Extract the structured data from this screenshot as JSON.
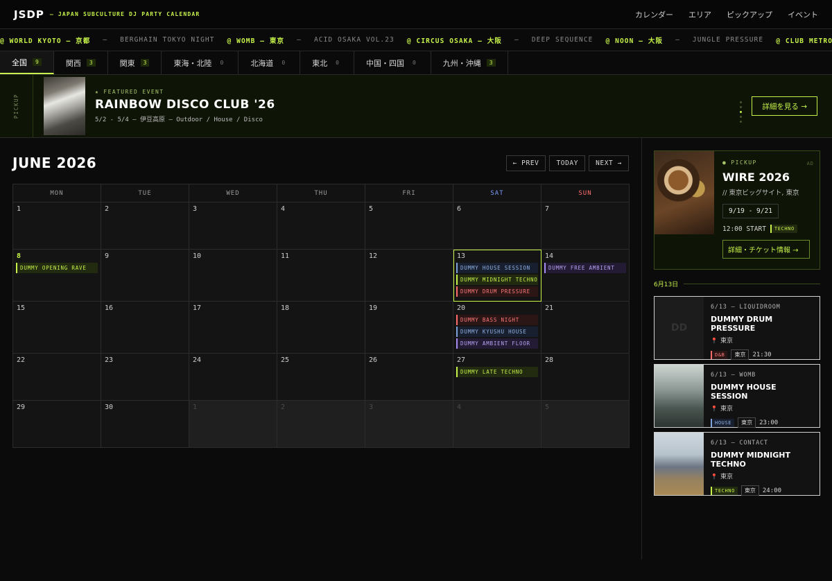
{
  "header": {
    "logo": "JSDP",
    "tagline": "— JAPAN SUBCULTURE DJ PARTY CALENDAR",
    "nav": [
      "カレンダー",
      "エリア",
      "ピックアップ",
      "イベント"
    ]
  },
  "ticker": [
    {
      "text": "@ WORLD KYOTO — 京都",
      "hl": true
    },
    {
      "text": "—",
      "hl": false
    },
    {
      "text": "BERGHAIN TOKYO NIGHT",
      "hl": false
    },
    {
      "text": "@ WOMB — 東京",
      "hl": true
    },
    {
      "text": "—",
      "hl": false
    },
    {
      "text": "ACID OSAKA VOL.23",
      "hl": false
    },
    {
      "text": "@ CIRCUS OSAKA — 大阪",
      "hl": true
    },
    {
      "text": "—",
      "hl": false
    },
    {
      "text": "DEEP SEQUENCE",
      "hl": false
    },
    {
      "text": "@ NOON — 大阪",
      "hl": true
    },
    {
      "text": "—",
      "hl": false
    },
    {
      "text": "JUNGLE PRESSURE",
      "hl": false
    },
    {
      "text": "@ CLUB METRO — 京",
      "hl": true
    }
  ],
  "tabs": [
    {
      "label": "全国",
      "count": "9",
      "active": true,
      "on": true
    },
    {
      "label": "関西",
      "count": "3",
      "active": false,
      "on": true
    },
    {
      "label": "関東",
      "count": "3",
      "active": false,
      "on": true
    },
    {
      "label": "東海・北陸",
      "count": "0",
      "active": false,
      "on": false
    },
    {
      "label": "北海道",
      "count": "0",
      "active": false,
      "on": false
    },
    {
      "label": "東北",
      "count": "0",
      "active": false,
      "on": false
    },
    {
      "label": "中国・四国",
      "count": "0",
      "active": false,
      "on": false
    },
    {
      "label": "九州・沖縄",
      "count": "3",
      "active": false,
      "on": true
    }
  ],
  "featured": {
    "side_label": "PICKUP",
    "label": "★ FEATURED EVENT",
    "title": "RAINBOW DISCO CLUB '26",
    "meta": "5/2 - 5/4 — 伊豆高原 — Outdoor / House / Disco",
    "button": "詳細を見る →"
  },
  "calendar": {
    "title": "JUNE 2026",
    "prev": "← PREV",
    "today": "TODAY",
    "next": "NEXT →",
    "dows": [
      "MON",
      "TUE",
      "WED",
      "THU",
      "FRI",
      "SAT",
      "SUN"
    ],
    "weeks": [
      {
        "h": 68,
        "days": [
          {
            "d": "1"
          },
          {
            "d": "2"
          },
          {
            "d": "3"
          },
          {
            "d": "4"
          },
          {
            "d": "5"
          },
          {
            "d": "6"
          },
          {
            "d": "7"
          }
        ]
      },
      {
        "h": 75,
        "days": [
          {
            "d": "8",
            "hl": true,
            "events": [
              {
                "t": "DUMMY OPENING RAVE",
                "g": "techno"
              }
            ]
          },
          {
            "d": "9"
          },
          {
            "d": "10"
          },
          {
            "d": "11"
          },
          {
            "d": "12"
          },
          {
            "d": "13",
            "sel": true,
            "events": [
              {
                "t": "DUMMY HOUSE SESSION",
                "g": "house"
              },
              {
                "t": "DUMMY MIDNIGHT TECHNO",
                "g": "techno"
              },
              {
                "t": "DUMMY DRUM PRESSURE",
                "g": "dnb"
              }
            ]
          },
          {
            "d": "14",
            "events": [
              {
                "t": "DUMMY FREE AMBIENT",
                "g": "ambient"
              }
            ]
          }
        ]
      },
      {
        "h": 75,
        "days": [
          {
            "d": "15"
          },
          {
            "d": "16"
          },
          {
            "d": "17"
          },
          {
            "d": "18"
          },
          {
            "d": "19"
          },
          {
            "d": "20",
            "events": [
              {
                "t": "DUMMY BASS NIGHT",
                "g": "dnb"
              },
              {
                "t": "DUMMY KYUSHU HOUSE",
                "g": "house"
              },
              {
                "t": "DUMMY AMBIENT FLOOR",
                "g": "ambient"
              }
            ]
          },
          {
            "d": "21"
          }
        ]
      },
      {
        "h": 68,
        "days": [
          {
            "d": "22"
          },
          {
            "d": "23"
          },
          {
            "d": "24"
          },
          {
            "d": "25"
          },
          {
            "d": "26"
          },
          {
            "d": "27",
            "events": [
              {
                "t": "DUMMY LATE TECHNO",
                "g": "techno"
              }
            ]
          },
          {
            "d": "28"
          }
        ]
      },
      {
        "h": 68,
        "days": [
          {
            "d": "29"
          },
          {
            "d": "30"
          },
          {
            "d": "1",
            "other": true
          },
          {
            "d": "2",
            "other": true
          },
          {
            "d": "3",
            "other": true
          },
          {
            "d": "4",
            "other": true
          },
          {
            "d": "5",
            "other": true
          }
        ]
      }
    ]
  },
  "ad": {
    "pick": "● PICKUP",
    "tag": "AD",
    "title": "WIRE 2026",
    "venue": "// 東京ビッグサイト, 東京",
    "date": "9/19 - 9/21",
    "time": "12:00 START",
    "genre": "TECHNO",
    "button": "詳細・チケット情報 →"
  },
  "day_label": "6月13日",
  "cards": [
    {
      "meta": "6/13 — LIQUIDROOM",
      "title": "DUMMY DRUM PRESSURE",
      "place": "東京",
      "genre": "D&B",
      "gclass": "dnb",
      "loc": "東京",
      "time": "21:30",
      "img": "ph",
      "ph": "DD"
    },
    {
      "meta": "6/13 — WOMB",
      "title": "DUMMY HOUSE SESSION",
      "place": "東京",
      "genre": "HOUSE",
      "gclass": "house",
      "loc": "東京",
      "time": "23:00",
      "img": "forest",
      "ph": ""
    },
    {
      "meta": "6/13 — CONTACT",
      "title": "DUMMY MIDNIGHT TECHNO",
      "place": "東京",
      "genre": "TECHNO",
      "gclass": "techno",
      "loc": "東京",
      "time": "24:00",
      "img": "mtn",
      "ph": ""
    }
  ]
}
